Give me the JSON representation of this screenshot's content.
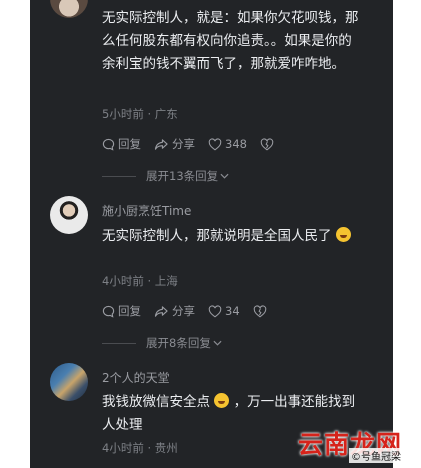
{
  "comments": [
    {
      "username": "",
      "text": "无实际控制人，就是：如果你欠花呗钱，那么任何股东都有权向你追责。。如果是你的余利宝的钱不翼而飞了，那就爱咋咋地。",
      "time": "5小时前",
      "location": "广东",
      "reply_label": "回复",
      "share_label": "分享",
      "likes": "348",
      "expand_label": "展开13条回复"
    },
    {
      "username": "施小厨烹饪Time",
      "text": "无实际控制人，那就说明是全国人民了",
      "emoji": "laughing-crying-emoji",
      "time": "4小时前",
      "location": "上海",
      "reply_label": "回复",
      "share_label": "分享",
      "likes": "34",
      "expand_label": "展开8条回复"
    },
    {
      "username": "2个人的天堂",
      "text_before_emoji": "我钱放微信安全点",
      "emoji": "laughing-crying-emoji",
      "text_after_emoji": "，万一出事还能找到人处理",
      "time": "4小时前",
      "location": "贵州"
    }
  ],
  "watermark": {
    "name": "云南龙网",
    "sub": "©号鱼冠梁"
  },
  "colors": {
    "panel_bg": "#222427",
    "text": "#eceef1",
    "meta": "#7d8086",
    "watermark_red": "#d6231b"
  }
}
